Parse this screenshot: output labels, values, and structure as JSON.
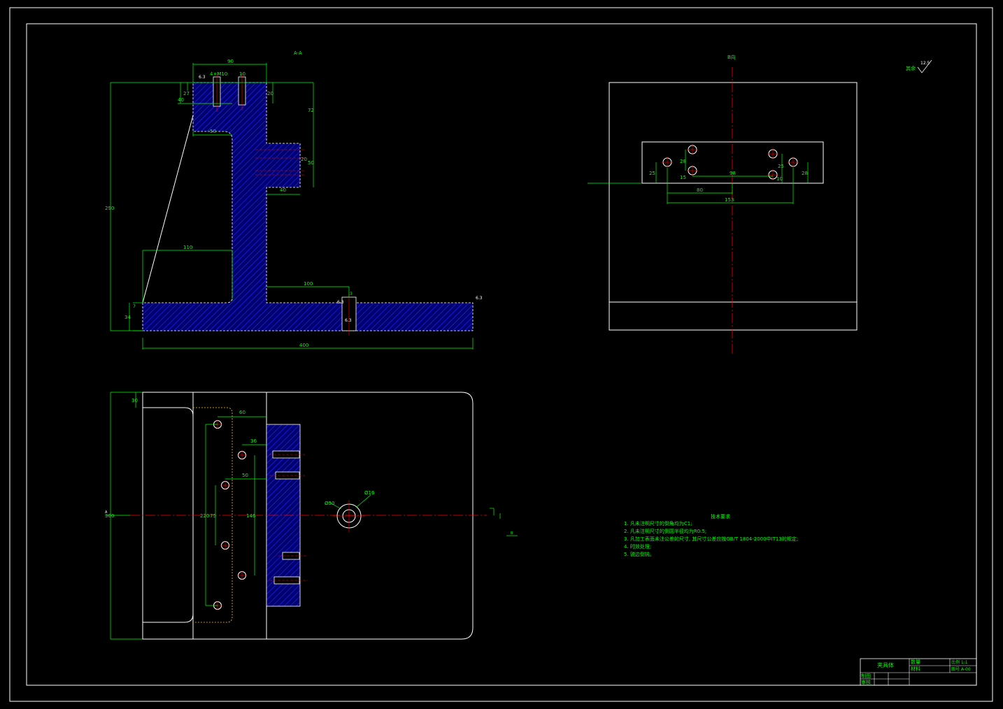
{
  "views": {
    "section_label": "A-A",
    "view_b_label": "B向",
    "roughness_note": "其余",
    "roughness_value": "12.5",
    "section_mark_a": "A",
    "section_mark_b": "B"
  },
  "dimensions": {
    "width_90": "90",
    "hole_callout": "4×M10",
    "dim_10": "10",
    "dim_20": "20",
    "dim_27": "27",
    "dim_40": "40",
    "dim_72": "72",
    "dim_50": "50",
    "dim_20b": "20",
    "dim_50b": "50",
    "dim_40b": "40",
    "height_290": "290",
    "dim_110": "110",
    "dim_100": "100",
    "dim_34": "34",
    "dim_7": "7",
    "length_400": "400",
    "dim_3": "3",
    "rough_ra_1": "6.3",
    "rough_ra_2": "6.3",
    "rough_ra_3": "6.3",
    "rough_ra_4": "6.3",
    "b_25": "25",
    "b_28": "28",
    "b_15": "15",
    "b_98": "98",
    "b_25b": "25",
    "b_10": "10",
    "b_28b": "28",
    "b_80": "80",
    "b_153": "153",
    "p_30": "30",
    "p_60": "60",
    "p_36": "36",
    "p_50": "50",
    "p_300": "300",
    "p_220": "220",
    "p_75": "75",
    "p_146": "146",
    "p_d30": "Ø30",
    "p_d16": "Ø16"
  },
  "technical_requirements": {
    "title": "技术要求",
    "items": [
      "1. 凡未注明尺寸的倒角均为C1;",
      "2. 凡未注明尺寸的倒圆半径均为R0.5;",
      "3. 凡加工表面未注公差的尺寸, 其尺寸公差应按GB/T 1804-2000中IT13的规定;",
      "4. 时效处理;",
      "5. 锐边倒钝。"
    ]
  },
  "title_block": {
    "part_name": "夹具体",
    "material_label": "数量",
    "weight_label": "材料",
    "scale_label": "比例 1:1",
    "drawing_no": "图号 A-00",
    "drawn_by": "制图",
    "checked_by": "审核"
  },
  "colors": {
    "background": "#000000",
    "outline": "#ffffff",
    "dimension": "#00ff00",
    "hatch": "#0000ff",
    "centerline": "#ff0000"
  }
}
